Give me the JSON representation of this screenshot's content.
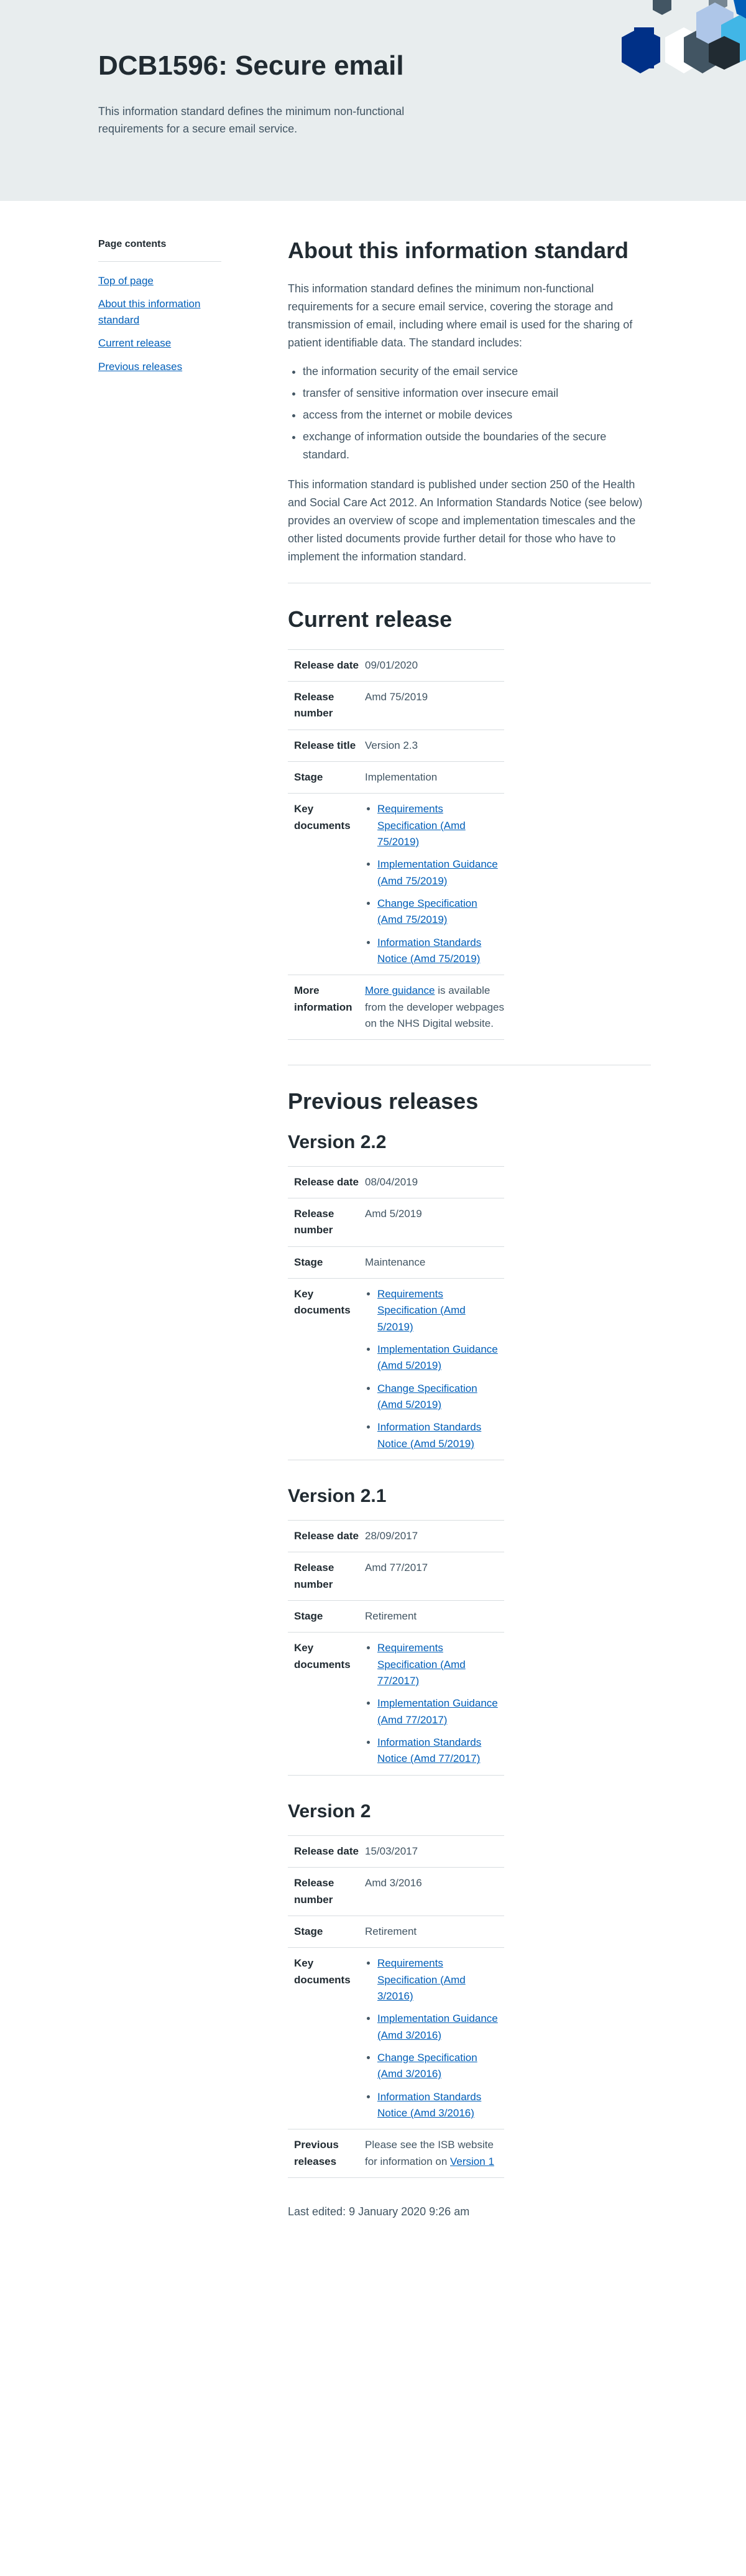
{
  "header": {
    "title": "DCB1596: Secure email",
    "intro": "This information standard defines the minimum non-functional requirements for a secure email service."
  },
  "sidebar": {
    "heading": "Page contents",
    "links": [
      "Top of page",
      "About this information standard",
      "Current release",
      "Previous releases"
    ]
  },
  "about": {
    "heading": "About this information standard",
    "para1": "This information standard defines the minimum non-functional requirements for a secure email service, covering the storage and transmission of email, including where email is used for the sharing of patient identifiable data. The standard includes:",
    "bullets": [
      "the information security of the email service",
      "transfer of sensitive information over insecure email",
      "access from the internet or mobile devices",
      "exchange of information outside the boundaries of the secure standard."
    ],
    "para2": "This information standard is published under section 250 of the Health and Social Care Act 2012. An Information Standards Notice (see below) provides an overview of scope and implementation timescales and the other listed documents provide further detail for those who have to implement the information standard."
  },
  "labels": {
    "release_date": "Release date",
    "release_number": "Release number",
    "release_title": "Release title",
    "stage": "Stage",
    "key_documents": "Key documents",
    "more_information": "More information",
    "previous_releases": "Previous releases"
  },
  "current": {
    "heading": "Current release",
    "release_date": "09/01/2020",
    "release_number": "Amd 75/2019",
    "release_title": "Version 2.3",
    "stage": "Implementation",
    "documents": [
      "Requirements Specification (Amd 75/2019)",
      "Implementation Guidance (Amd 75/2019)",
      "Change Specification (Amd 75/2019)",
      "Information Standards Notice (Amd 75/2019)"
    ],
    "more_link": "More guidance",
    "more_text": " is available from the developer webpages on the NHS Digital website."
  },
  "previous": {
    "heading": "Previous releases",
    "v22": {
      "title": "Version 2.2",
      "release_date": "08/04/2019",
      "release_number": "Amd 5/2019",
      "stage": "Maintenance",
      "documents": [
        "Requirements Specification (Amd 5/2019)",
        "Implementation Guidance (Amd 5/2019)",
        "Change Specification (Amd 5/2019)",
        "Information Standards Notice (Amd 5/2019)"
      ]
    },
    "v21": {
      "title": "Version 2.1",
      "release_date": "28/09/2017",
      "release_number": "Amd 77/2017",
      "stage": "Retirement",
      "documents": [
        "Requirements Specification (Amd 77/2017)",
        "Implementation Guidance (Amd 77/2017)",
        "Information Standards Notice (Amd 77/2017)"
      ]
    },
    "v2": {
      "title": "Version 2",
      "release_date": "15/03/2017",
      "release_number": "Amd 3/2016",
      "stage": "Retirement",
      "documents": [
        "Requirements Specification (Amd 3/2016)",
        "Implementation Guidance (Amd 3/2016)",
        "Change Specification (Amd 3/2016)",
        "Information Standards Notice (Amd 3/2016)"
      ],
      "previous_text": "Please see the ISB website for information on ",
      "previous_link": "Version 1"
    }
  },
  "footer": {
    "last_edited": "Last edited: 9 January 2020 9:26 am"
  },
  "colors": {
    "hero_bg": "#e8edee",
    "link": "#005eb8",
    "text": "#212b32",
    "secondary": "#425563"
  }
}
